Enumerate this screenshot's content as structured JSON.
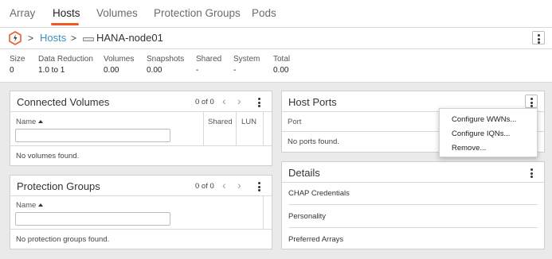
{
  "tabs": [
    {
      "label": "Array"
    },
    {
      "label": "Hosts"
    },
    {
      "label": "Volumes"
    },
    {
      "label": "Protection Groups"
    },
    {
      "label": "Pods"
    }
  ],
  "active_tab": "Hosts",
  "accent_color": "#ee5a24",
  "link_color": "#3a8fc1",
  "breadcrumb": {
    "separator": ">",
    "parent": "Hosts",
    "current": "HANA-node01",
    "host_icon": "host-icon"
  },
  "stats": [
    {
      "label": "Size",
      "value": "0"
    },
    {
      "label": "Data Reduction",
      "value": "1.0 to 1"
    },
    {
      "label": "Volumes",
      "value": "0.00"
    },
    {
      "label": "Snapshots",
      "value": "0.00"
    },
    {
      "label": "Shared",
      "value": "-"
    },
    {
      "label": "System",
      "value": "-"
    },
    {
      "label": "Total",
      "value": "0.00"
    }
  ],
  "connected_volumes": {
    "title": "Connected Volumes",
    "pager": "0 of 0",
    "columns": [
      "Name",
      "Shared",
      "LUN"
    ],
    "empty": "No volumes found."
  },
  "protection_groups": {
    "title": "Protection Groups",
    "pager": "0 of 0",
    "columns": [
      "Name"
    ],
    "empty": "No protection groups found."
  },
  "host_ports": {
    "title": "Host Ports",
    "columns": [
      "Port"
    ],
    "empty": "No ports found.",
    "menu": [
      "Configure WWNs...",
      "Configure IQNs...",
      "Remove..."
    ]
  },
  "details": {
    "title": "Details",
    "rows": [
      "CHAP Credentials",
      "Personality",
      "Preferred Arrays"
    ]
  }
}
